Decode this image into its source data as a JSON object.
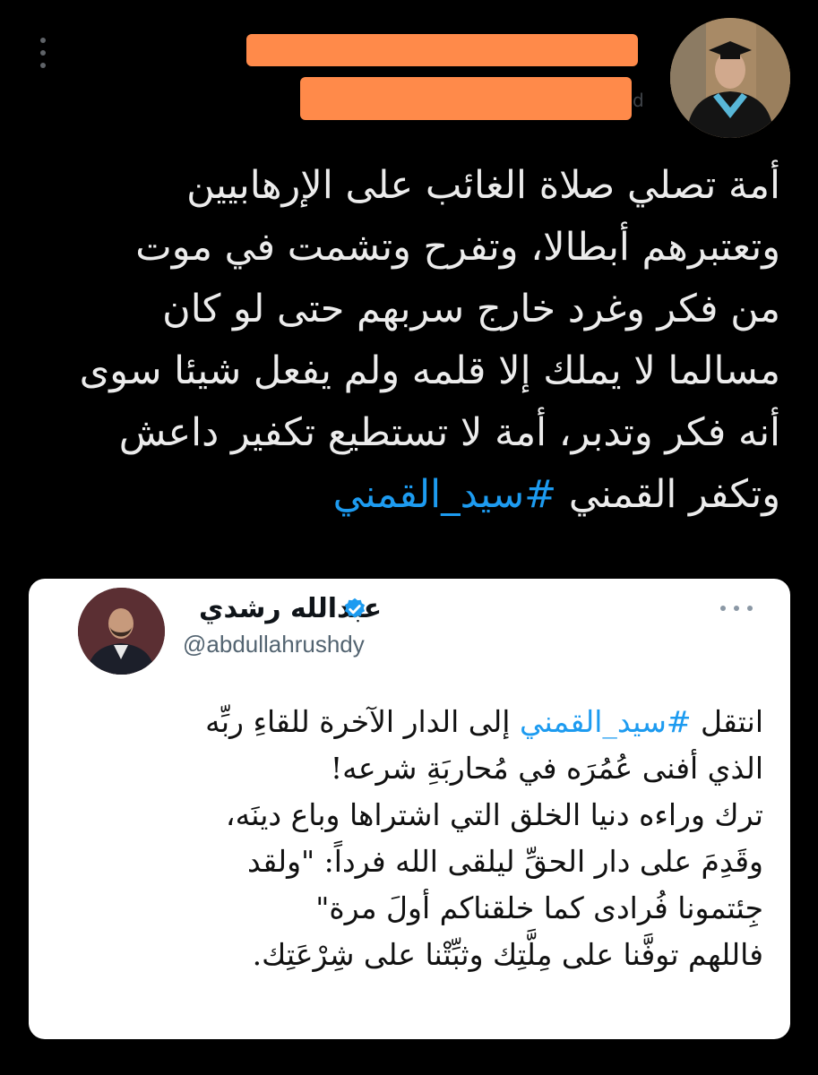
{
  "tweet": {
    "text_lines": [
      "أمة تصلي صلاة الغائب على الإرهابيين",
      "وتعتبرهم أبطالا، وتفرح وتشمت في موت",
      "من فكر وغرد خارج سربهم حتى لو كان",
      "مسالما لا يملك إلا قلمه ولم يفعل شيئا سوى",
      "أنه فكر وتدبر، أمة لا تستطيع تكفير داعش"
    ],
    "last_line_text": "وتكفر القمني",
    "hashtag": "#سيد_القمني",
    "avatar_icon": "graduation-portrait",
    "more_icon": "vertical-ellipsis",
    "redaction_color": "#ff8a4a"
  },
  "quote": {
    "display_name": "عبدالله رشدي",
    "handle": "@abdullahrushdy",
    "verified_icon": "verified-badge",
    "verified_color": "#1d9bf0",
    "more_icon": "horizontal-ellipsis",
    "first_line_start": "انتقل",
    "hashtag": "#سيد_القمني",
    "first_line_end": "إلى الدار الآخرة للقاءِ ربِّه",
    "text_lines": [
      "الذي أفنى عُمُرَه في مُحاربَةِ شرعه!",
      "ترك وراءه دنيا الخلق التي اشتراها وباع دينَه،",
      "وقَدِمَ على دار الحقِّ ليلقى الله فرداً: \"ولقد",
      "جِئتمونا فُرادى كما خلقناكم أولَ مرة\"",
      "فاللهم توفَّنا على مِلَّتِك وثبِّتْنا على شِرْعَتِك."
    ]
  }
}
